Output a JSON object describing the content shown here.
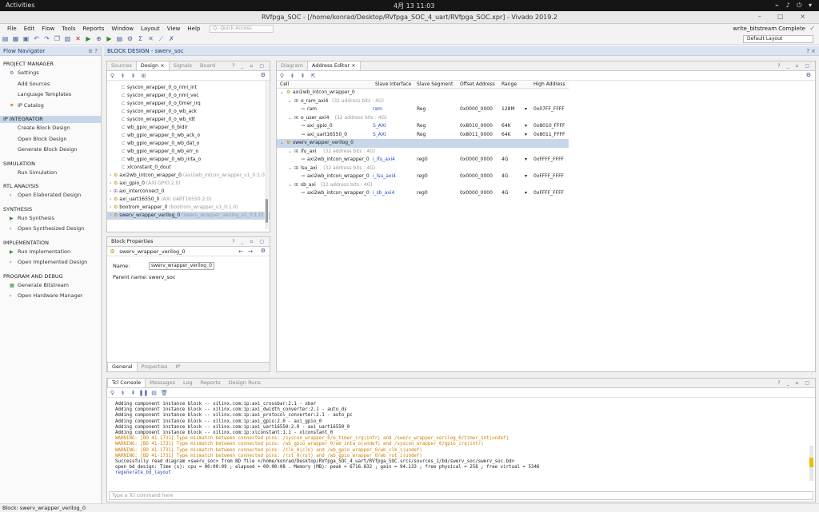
{
  "topbar": {
    "activities": "Activities",
    "clock": "4月 13  11:03",
    "tray": "⌁ ♪ ⏻ ▾"
  },
  "titlebar": {
    "title": "RVfpga_SOC - [/home/konrad/Desktop/RVfpga_SOC_4_uart/RVfpga_SOC.xpr] - Vivado 2019.2",
    "ctrls": "– □ ×"
  },
  "menu": {
    "items": [
      "File",
      "Edit",
      "Flow",
      "Tools",
      "Reports",
      "Window",
      "Layout",
      "View",
      "Help"
    ],
    "quick_access_placeholder": "Q- Quick Access",
    "status": "write_bitstream Complete",
    "status_icon": "✓"
  },
  "toolbar": {
    "layout": "Default Layout"
  },
  "flow_nav": {
    "title": "Flow Navigator",
    "sections": [
      {
        "label": "PROJECT MANAGER",
        "items": [
          "Settings",
          "Add Sources",
          "Language Templates",
          "IP Catalog"
        ]
      },
      {
        "label": "IP INTEGRATOR",
        "items": [
          "Create Block Design",
          "Open Block Design",
          "Generate Block Design"
        ]
      },
      {
        "label": "SIMULATION",
        "items": [
          "Run Simulation"
        ]
      },
      {
        "label": "RTL ANALYSIS",
        "items": [
          "Open Elaborated Design"
        ]
      },
      {
        "label": "SYNTHESIS",
        "items": [
          "Run Synthesis",
          "Open Synthesized Design"
        ]
      },
      {
        "label": "IMPLEMENTATION",
        "items": [
          "Run Implementation",
          "Open Implemented Design"
        ]
      },
      {
        "label": "PROGRAM AND DEBUG",
        "items": [
          "Generate Bitstream",
          "Open Hardware Manager"
        ]
      }
    ]
  },
  "block_design": {
    "title": "BLOCK DESIGN - swerv_soc",
    "help": "?  ×"
  },
  "sources": {
    "tabs": [
      "Sources",
      "Design",
      "Signals",
      "Board"
    ],
    "lines": [
      "syscon_wrapper_0_o_nmi_int",
      "syscon_wrapper_0_o_nmi_vec",
      "syscon_wrapper_0_o_timer_irq",
      "syscon_wrapper_0_o_wb_ack",
      "syscon_wrapper_0_o_wb_rdt",
      "wb_gpio_wrapper_0_bidir",
      "wb_gpio_wrapper_0_wb_ack_o",
      "wb_gpio_wrapper_0_wb_dat_o",
      "wb_gpio_wrapper_0_wb_err_o",
      "wb_gpio_wrapper_0_wb_inta_o",
      "xlconstant_0_dout"
    ],
    "instances": [
      {
        "name": "axi2wb_intcon_wrapper_0",
        "ip": "(axi2wb_intcon_wrapper_v1_0:1.0)"
      },
      {
        "name": "axi_gpio_0",
        "ip": "(AXI GPIO:2.0)"
      },
      {
        "name": "axi_interconnect_0",
        "ip": ""
      },
      {
        "name": "axi_uart16550_0",
        "ip": "(AXI UART16550:2.0)"
      },
      {
        "name": "bootrom_wrapper_0",
        "ip": "(bootrom_wrapper_v1_0:1.0)"
      },
      {
        "name": "swerv_wrapper_verilog_0",
        "ip": "(swerv_wrapper_verilog_v1_0:1.0)"
      }
    ]
  },
  "block_properties": {
    "title": "Block Properties",
    "block": "swerv_wrapper_verilog_0",
    "name_label": "Name:",
    "name_value": "swerv_wrapper_verilog_0",
    "parent_label": "Parent name:",
    "parent_value": "swerv_soc",
    "tabs": [
      "General",
      "Properties",
      "IP"
    ]
  },
  "address_editor": {
    "tabs": [
      "Diagram",
      "Address Editor"
    ],
    "columns": [
      "Cell",
      "Slave Interface",
      "Slave Segment",
      "Offset Address",
      "Range",
      "High Address"
    ],
    "rows": [
      {
        "l": 0,
        "cell": "axi2wb_intcon_wrapper_0",
        "note": "",
        "si": "",
        "seg": "",
        "off": "",
        "range": "",
        "high": ""
      },
      {
        "l": 1,
        "cell": "o_ram_axi4",
        "note": "(32 address bits : 4G)",
        "si": "",
        "seg": "",
        "off": "",
        "range": "",
        "high": ""
      },
      {
        "l": 2,
        "cell": "ram",
        "note": "",
        "si": "ram",
        "seg": "Reg",
        "off": "0x0000_0000",
        "range": "128M",
        "high": "0x07FF_FFFF"
      },
      {
        "l": 1,
        "cell": "o_user_axi4",
        "note": "(32 address bits : 4G)",
        "si": "",
        "seg": "",
        "off": "",
        "range": "",
        "high": ""
      },
      {
        "l": 2,
        "cell": "axi_gpio_0",
        "note": "",
        "si": "S_AXI",
        "seg": "Reg",
        "off": "0x8010_0000",
        "range": "64K",
        "high": "0x8010_FFFF"
      },
      {
        "l": 2,
        "cell": "axi_uart16550_0",
        "note": "",
        "si": "S_AXI",
        "seg": "Reg",
        "off": "0x8011_0000",
        "range": "64K",
        "high": "0x8011_FFFF"
      },
      {
        "l": 0,
        "cell": "swerv_wrapper_verilog_0",
        "note": "",
        "si": "",
        "seg": "",
        "off": "",
        "range": "",
        "high": "",
        "sel": true
      },
      {
        "l": 1,
        "cell": "ifu_axi",
        "note": "(32 address bits : 4G)",
        "si": "",
        "seg": "",
        "off": "",
        "range": "",
        "high": ""
      },
      {
        "l": 2,
        "cell": "axi2wb_intcon_wrapper_0",
        "note": "",
        "si": "i_ifu_axi4",
        "seg": "reg0",
        "off": "0x0000_0000",
        "range": "4G",
        "high": "0xFFFF_FFFF"
      },
      {
        "l": 1,
        "cell": "lsu_axi",
        "note": "(32 address bits : 4G)",
        "si": "",
        "seg": "",
        "off": "",
        "range": "",
        "high": ""
      },
      {
        "l": 2,
        "cell": "axi2wb_intcon_wrapper_0",
        "note": "",
        "si": "i_lsu_axi4",
        "seg": "reg0",
        "off": "0x0000_0000",
        "range": "4G",
        "high": "0xFFFF_FFFF"
      },
      {
        "l": 1,
        "cell": "sb_axi",
        "note": "(32 address bits : 4G)",
        "si": "",
        "seg": "",
        "off": "",
        "range": "",
        "high": ""
      },
      {
        "l": 2,
        "cell": "axi2wb_intcon_wrapper_0",
        "note": "",
        "si": "i_sb_axi4",
        "seg": "reg0",
        "off": "0x0000_0000",
        "range": "4G",
        "high": "0xFFFF_FFFF"
      }
    ]
  },
  "tcl": {
    "tabs": [
      "Tcl Console",
      "Messages",
      "Log",
      "Reports",
      "Design Runs"
    ],
    "lines": [
      {
        "t": "n",
        "s": "Adding component instance block -- xilinx.com:ip:axi_crossbar:2.1 - xbar"
      },
      {
        "t": "n",
        "s": "Adding component instance block -- xilinx.com:ip:axi_dwidth_converter:2.1 - auto_ds"
      },
      {
        "t": "n",
        "s": "Adding component instance block -- xilinx.com:ip:axi_protocol_converter:2.1 - auto_pc"
      },
      {
        "t": "n",
        "s": "Adding component instance block -- xilinx.com:ip:axi_gpio:2.0 - axi_gpio_0"
      },
      {
        "t": "n",
        "s": "Adding component instance block -- xilinx.com:ip:axi_uart16550:2.0 - axi_uart16550_0"
      },
      {
        "t": "n",
        "s": "Adding component instance block -- xilinx.com:ip:xlconstant:1.1 - xlconstant_0"
      },
      {
        "t": "w",
        "s": "WARNING: [BD 41-1731] Type mismatch between connected pins: /syscon_wrapper_0/o_timer_irq(intr) and /swerv_wrapper_verilog_0/timer_int(undef)"
      },
      {
        "t": "w",
        "s": "WARNING: [BD 41-1731] Type mismatch between connected pins: /wb_gpio_wrapper_0/wb_inta_o(undef) and /syscon_wrapper_0/gpio_irq(intr)"
      },
      {
        "t": "w",
        "s": "WARNING: [BD 41-1731] Type mismatch between connected pins: /clk_0(clk) and /wb_gpio_wrapper_0/wb_clk_i(undef)"
      },
      {
        "t": "w",
        "s": "WARNING: [BD 41-1731] Type mismatch between connected pins: /rst_0(rst) and /wb_gpio_wrapper_0/wb_rst_i(undef)"
      },
      {
        "t": "n",
        "s": "Successfully read diagram <swerv_soc> from BD file </home/konrad/Desktop/RVfpga_SOC_4_uart/RVfpga_SOC.srcs/sources_1/bd/swerv_soc/swerv_soc.bd>"
      },
      {
        "t": "n",
        "s": "open_bd_design: Time (s): cpu = 00:00:09 ; elapsed = 00:00:08 . Memory (MB): peak = 6716.832 ; gain = 94.133 ; free physical = 258 ; free virtual = 5346"
      },
      {
        "t": "l",
        "s": "regenerate_bd_layout"
      }
    ],
    "input_placeholder": "Type a Tcl command here"
  },
  "statusbar": "Block: swerv_wrapper_verilog_0"
}
